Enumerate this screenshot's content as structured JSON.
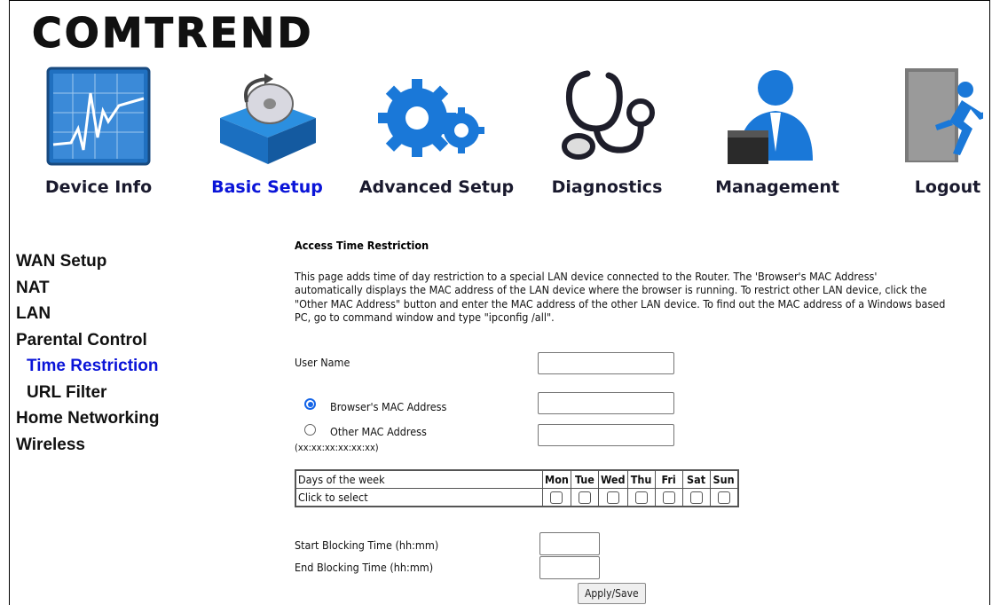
{
  "brand": {
    "logo_text": "COMTREND"
  },
  "nav": {
    "items": [
      {
        "label": "Device Info",
        "icon": "device-info-chart-icon"
      },
      {
        "label": "Basic Setup",
        "icon": "basic-setup-box-disc-icon",
        "active": true
      },
      {
        "label": "Advanced Setup",
        "icon": "gears-icon"
      },
      {
        "label": "Diagnostics",
        "icon": "stethoscope-icon"
      },
      {
        "label": "Management",
        "icon": "admin-user-icon"
      },
      {
        "label": "Logout",
        "icon": "exit-door-icon"
      }
    ]
  },
  "sidebar": {
    "items": [
      {
        "label": "WAN Setup"
      },
      {
        "label": "NAT"
      },
      {
        "label": "LAN"
      },
      {
        "label": "Parental Control"
      },
      {
        "label": "Time Restriction",
        "active": true,
        "sub": true
      },
      {
        "label": "URL Filter",
        "sub": true
      },
      {
        "label": "Home Networking"
      },
      {
        "label": "Wireless"
      }
    ]
  },
  "content": {
    "title": "Access Time Restriction",
    "description": "This page adds time of day restriction to a special LAN device connected to the Router. The 'Browser's MAC Address' automatically displays the MAC address of the LAN device where the browser is running. To restrict other LAN device, click the \"Other MAC Address\" button and enter the MAC address of the other LAN device. To find out the MAC address of a Windows based PC, go to command window and type \"ipconfig /all\".",
    "user_name_label": "User Name",
    "user_name_value": "",
    "browser_mac_label": "Browser's MAC Address",
    "browser_mac_value": "",
    "other_mac_label": "Other MAC Address",
    "other_mac_hint": "(xx:xx:xx:xx:xx:xx)",
    "other_mac_value": "",
    "mac_selection": "browser",
    "days_table": {
      "header_label": "Days of the week",
      "row_label": "Click to select",
      "days": [
        "Mon",
        "Tue",
        "Wed",
        "Thu",
        "Fri",
        "Sat",
        "Sun"
      ]
    },
    "start_label": "Start Blocking Time (hh:mm)",
    "end_label": "End Blocking Time (hh:mm)",
    "start_value": "",
    "end_value": "",
    "apply_label": "Apply/Save"
  },
  "colors": {
    "active_link": "#0a14d8",
    "text": "#111111"
  }
}
